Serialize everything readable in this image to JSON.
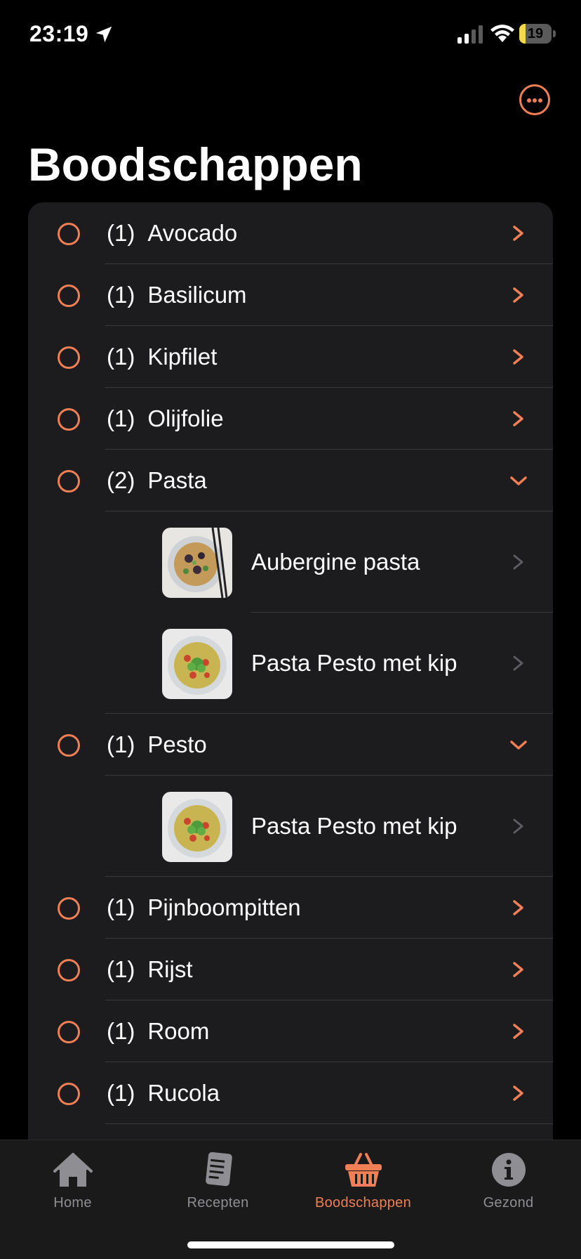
{
  "status_bar": {
    "time": "23:19",
    "battery_level": "19",
    "battery_fraction": 0.19,
    "icons": [
      "location-arrow-icon",
      "cellular-signal-icon",
      "wifi-icon",
      "battery-charging-icon"
    ]
  },
  "header": {
    "title": "Boodschappen",
    "more_icon": "ellipsis-circle-icon"
  },
  "colors": {
    "accent": "#f07f55",
    "background": "#000000",
    "card": "#1c1c1e",
    "separator": "#38383a",
    "muted": "#8e8e93"
  },
  "items": [
    {
      "count": "(1)",
      "name": "Avocado",
      "expanded": false
    },
    {
      "count": "(1)",
      "name": "Basilicum",
      "expanded": false
    },
    {
      "count": "(1)",
      "name": "Kipfilet",
      "expanded": false
    },
    {
      "count": "(1)",
      "name": "Olijfolie",
      "expanded": false
    },
    {
      "count": "(2)",
      "name": "Pasta",
      "expanded": true,
      "recipes": [
        {
          "name": "Aubergine pasta",
          "image": "aubergine-pasta-thumbnail"
        },
        {
          "name": "Pasta Pesto met kip",
          "image": "pasta-pesto-thumbnail"
        }
      ]
    },
    {
      "count": "(1)",
      "name": "Pesto",
      "expanded": true,
      "recipes": [
        {
          "name": "Pasta Pesto met kip",
          "image": "pasta-pesto-thumbnail"
        }
      ]
    },
    {
      "count": "(1)",
      "name": "Pijnboompitten",
      "expanded": false
    },
    {
      "count": "(1)",
      "name": "Rijst",
      "expanded": false
    },
    {
      "count": "(1)",
      "name": "Room",
      "expanded": false
    },
    {
      "count": "(1)",
      "name": "Rucola",
      "expanded": false
    }
  ],
  "tabs": [
    {
      "label": "Home",
      "icon": "house-icon",
      "active": false
    },
    {
      "label": "Recepten",
      "icon": "book-icon",
      "active": false
    },
    {
      "label": "Boodschappen",
      "icon": "basket-icon",
      "active": true
    },
    {
      "label": "Gezond",
      "icon": "info-circle-icon",
      "active": false
    }
  ]
}
